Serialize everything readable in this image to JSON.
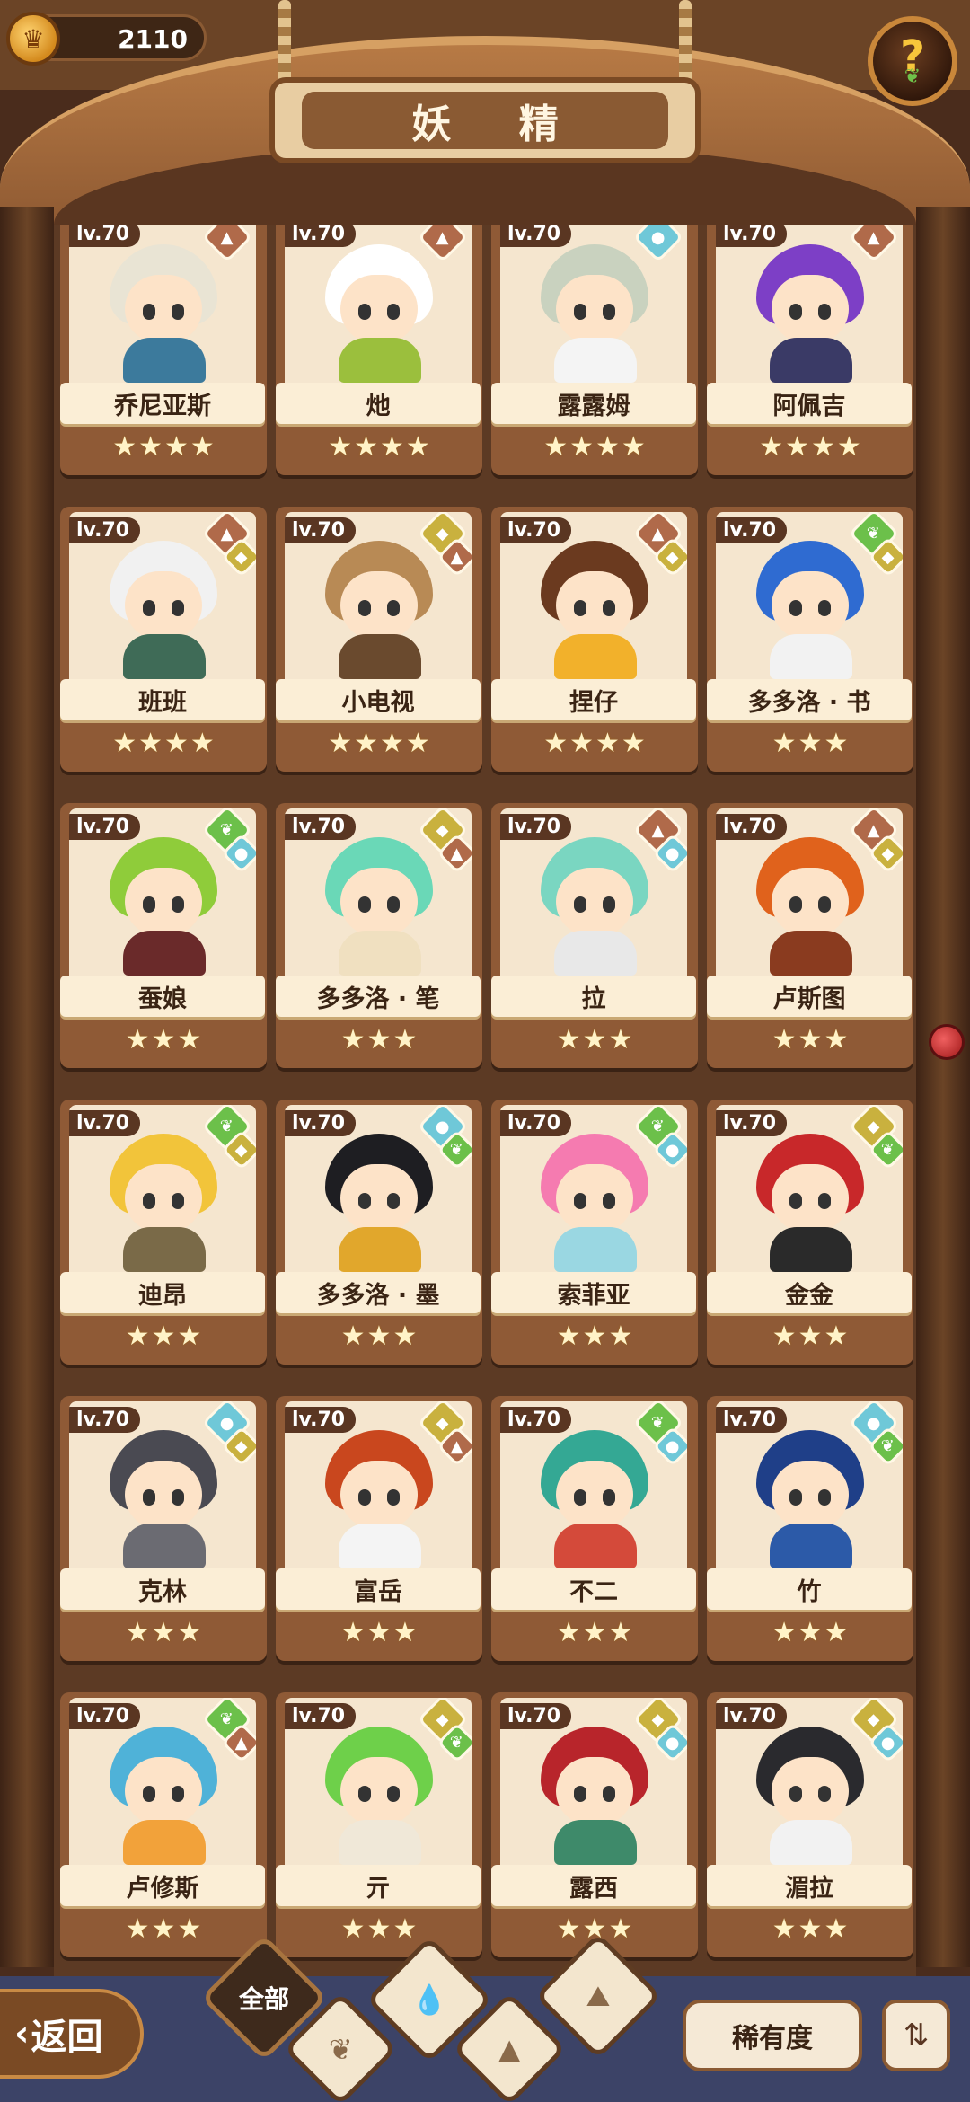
{
  "header": {
    "currency_value": "2110",
    "currency_icon": "crown-coin-icon",
    "title": "妖 精",
    "help_label": "?"
  },
  "cards": [
    {
      "name": "乔尼亚斯",
      "level": "lv.70",
      "stars": "★★★★",
      "hair": "#e9e4d4",
      "body": "#3c7a9c",
      "elements": [
        "mountain"
      ]
    },
    {
      "name": "灺",
      "level": "lv.70",
      "stars": "★★★★",
      "hair": "#ffffff",
      "body": "#9bbf3d",
      "elements": [
        "mountain"
      ]
    },
    {
      "name": "露露姆",
      "level": "lv.70",
      "stars": "★★★★",
      "hair": "#c9d2bf",
      "body": "#f4f4f4",
      "elements": [
        "water"
      ]
    },
    {
      "name": "阿佩吉",
      "level": "lv.70",
      "stars": "★★★★",
      "hair": "#7d3fc6",
      "body": "#3a3a66",
      "elements": [
        "mountain"
      ]
    },
    {
      "name": "班班",
      "level": "lv.70",
      "stars": "★★★★",
      "hair": "#f1f1f1",
      "body": "#3f6b57",
      "elements": [
        "mountain",
        "earth"
      ]
    },
    {
      "name": "小电视",
      "level": "lv.70",
      "stars": "★★★★",
      "hair": "#b88a55",
      "body": "#6a4a2e",
      "elements": [
        "earth",
        "mountain"
      ]
    },
    {
      "name": "捏仔",
      "level": "lv.70",
      "stars": "★★★★",
      "hair": "#6b3a1f",
      "body": "#f2b12b",
      "elements": [
        "mountain",
        "earth"
      ]
    },
    {
      "name": "多多洛 · 书",
      "level": "lv.70",
      "stars": "★★★",
      "hair": "#2f6bd1",
      "body": "#f2f2f2",
      "elements": [
        "leaf",
        "earth"
      ]
    },
    {
      "name": "蚕娘",
      "level": "lv.70",
      "stars": "★★★",
      "hair": "#8fcc3a",
      "body": "#6a2a2a",
      "elements": [
        "leaf",
        "water"
      ]
    },
    {
      "name": "多多洛 · 笔",
      "level": "lv.70",
      "stars": "★★★",
      "hair": "#6ad8b7",
      "body": "#f0e0c0",
      "elements": [
        "earth",
        "mountain"
      ]
    },
    {
      "name": "拉",
      "level": "lv.70",
      "stars": "★★★",
      "hair": "#7ad6c1",
      "body": "#e8e8e8",
      "elements": [
        "mountain",
        "water"
      ]
    },
    {
      "name": "卢斯图",
      "level": "lv.70",
      "stars": "★★★",
      "hair": "#e0621c",
      "body": "#8a3b1f",
      "elements": [
        "mountain",
        "earth"
      ]
    },
    {
      "name": "迪昂",
      "level": "lv.70",
      "stars": "★★★",
      "hair": "#f2c43a",
      "body": "#7a6a48",
      "elements": [
        "leaf",
        "earth"
      ]
    },
    {
      "name": "多多洛 · 墨",
      "level": "lv.70",
      "stars": "★★★",
      "hair": "#1e1e22",
      "body": "#e1a72c",
      "elements": [
        "water",
        "leaf"
      ]
    },
    {
      "name": "索菲亚",
      "level": "lv.70",
      "stars": "★★★",
      "hair": "#f57bb0",
      "body": "#9ad7e2",
      "elements": [
        "leaf",
        "water"
      ]
    },
    {
      "name": "金金",
      "level": "lv.70",
      "stars": "★★★",
      "hair": "#c8282a",
      "body": "#2a2a2a",
      "elements": [
        "earth",
        "leaf"
      ]
    },
    {
      "name": "克林",
      "level": "lv.70",
      "stars": "★★★",
      "hair": "#4a4a52",
      "body": "#6b6b72",
      "elements": [
        "water",
        "earth"
      ]
    },
    {
      "name": "富岳",
      "level": "lv.70",
      "stars": "★★★",
      "hair": "#c9471e",
      "body": "#f4f4f4",
      "elements": [
        "earth",
        "mountain"
      ]
    },
    {
      "name": "不二",
      "level": "lv.70",
      "stars": "★★★",
      "hair": "#34a894",
      "body": "#d44a3a",
      "elements": [
        "leaf",
        "water"
      ]
    },
    {
      "name": "竹",
      "level": "lv.70",
      "stars": "★★★",
      "hair": "#1f3f88",
      "body": "#2c5aa8",
      "elements": [
        "water",
        "leaf"
      ]
    },
    {
      "name": "卢修斯",
      "level": "lv.70",
      "stars": "★★★",
      "hair": "#4fb2d8",
      "body": "#f2a23a",
      "elements": [
        "leaf",
        "mountain"
      ]
    },
    {
      "name": "亓",
      "level": "lv.70",
      "stars": "★★★",
      "hair": "#6ed04a",
      "body": "#f0e8d8",
      "elements": [
        "earth",
        "leaf"
      ]
    },
    {
      "name": "露西",
      "level": "lv.70",
      "stars": "★★★",
      "hair": "#b8252b",
      "body": "#3e8a6a",
      "elements": [
        "earth",
        "water"
      ]
    },
    {
      "name": "湄拉",
      "level": "lv.70",
      "stars": "★★★",
      "hair": "#2a2a2e",
      "body": "#f2f2f2",
      "elements": [
        "earth",
        "water"
      ]
    }
  ],
  "element_colors": {
    "mountain": "#b06a4a",
    "earth": "#c9b13e",
    "water": "#6fc8d8",
    "leaf": "#6cc04a"
  },
  "footer": {
    "back_label": "返回",
    "filter_all_label": "全部",
    "filter_icons": [
      "leaf-icon",
      "water-icon",
      "earth-icon",
      "mountain-icon"
    ],
    "sort_label": "稀有度",
    "order_icon": "sort-order-icon"
  }
}
